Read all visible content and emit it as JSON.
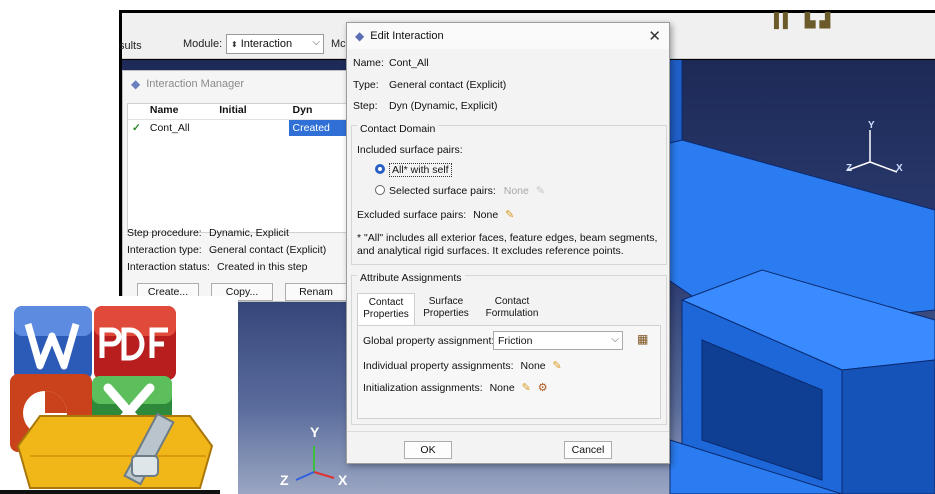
{
  "app": {
    "results_tab": "sults",
    "module_label": "Module:",
    "module_value": "Interaction",
    "model_label": "Mc",
    "toolbar_icons": "▐▌ ▙▟"
  },
  "interaction_manager": {
    "title": "Interaction Manager",
    "columns": [
      "Name",
      "Initial",
      "Dyn"
    ],
    "rows": [
      {
        "check": "✓",
        "name": "Cont_All",
        "initial": "",
        "dyn": "Created"
      }
    ],
    "step_procedure_label": "Step procedure:",
    "step_procedure_value": "Dynamic, Explicit",
    "interaction_type_label": "Interaction type:",
    "interaction_type_value": "General contact (Explicit)",
    "interaction_status_label": "Interaction status:",
    "interaction_status_value": "Created in this step",
    "buttons": {
      "create": "Create...",
      "copy": "Copy...",
      "rename": "Renam"
    }
  },
  "viewport": {
    "triad_small": {
      "y": "Y",
      "z": "Z",
      "x": "X"
    },
    "triad_large": {
      "y": "Y",
      "z": "Z",
      "x": "X"
    }
  },
  "edit_interaction": {
    "title": "Edit Interaction",
    "close_glyph": "✕",
    "name_label": "Name:",
    "name_value": "Cont_All",
    "type_label": "Type:",
    "type_value": "General contact (Explicit)",
    "step_label": "Step:",
    "step_value": "Dyn (Dynamic, Explicit)",
    "contact_domain_title": "Contact Domain",
    "included_label": "Included surface pairs:",
    "option_all": "All* with self",
    "option_selected": "Selected surface pairs:",
    "selected_value": "None",
    "excluded_label": "Excluded surface pairs:",
    "excluded_value": "None",
    "note_line1": "* \"All\" includes all exterior faces, feature edges, beam segments,",
    "note_line2": "and analytical rigid surfaces. It excludes reference points.",
    "attribute_title": "Attribute Assignments",
    "tabs": [
      {
        "line1": "Contact",
        "line2": "Properties"
      },
      {
        "line1": "Surface",
        "line2": "Properties"
      },
      {
        "line1": "Contact",
        "line2": "Formulation"
      }
    ],
    "global_label": "Global property assignment:",
    "global_value": "Friction",
    "individual_label": "Individual property assignments:",
    "individual_value": "None",
    "init_label": "Initialization assignments:",
    "init_value": "None",
    "ok": "OK",
    "cancel": "Cancel"
  },
  "colors": {
    "selection_blue": "#2f6fd6",
    "part_blue": "#1f6fe0",
    "pencil_orange": "#d79a1a"
  }
}
